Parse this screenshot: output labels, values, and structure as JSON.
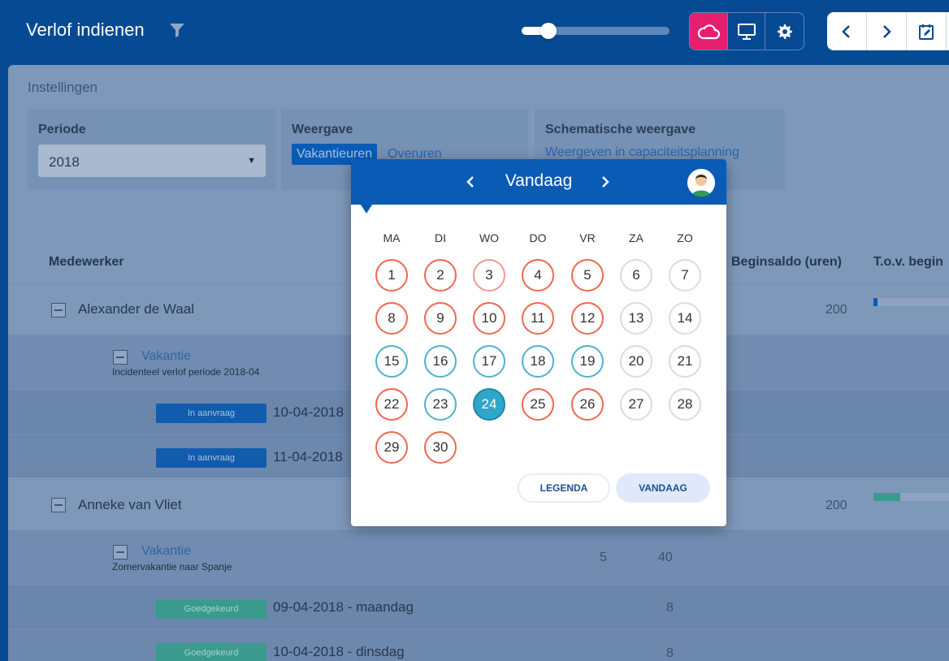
{
  "header": {
    "title": "Verlof indienen",
    "zoom_level": 0.18
  },
  "settings": {
    "title": "Instellingen",
    "periode": {
      "label": "Periode",
      "value": "2018"
    },
    "weergave": {
      "label": "Weergave",
      "options": [
        "Vakantieuren",
        "Overuren"
      ],
      "selected": "Vakantieuren"
    },
    "schematisch": {
      "label": "Schematische weergave",
      "link": "Weergeven in capaciteitsplanning"
    }
  },
  "table": {
    "headers": {
      "employee": "Medewerker",
      "start_balance": "Beginsaldo (uren)",
      "compared": "T.o.v. begin"
    },
    "employees": [
      {
        "name": "Alexander de Waal",
        "start_balance": "200",
        "bar_fraction": 0.05,
        "category": "Vakantie",
        "description": "Incidenteel verlof periode 2018-04",
        "requests": [
          {
            "status": "In aanvraag",
            "date": "10-04-2018"
          },
          {
            "status": "In aanvraag",
            "date": "11-04-2018"
          }
        ]
      },
      {
        "name": "Anneke van Vliet",
        "start_balance": "200",
        "bar_fraction": 0.35,
        "category": "Vakantie",
        "description": "Zomervakantie naar Spanje",
        "cat_days": "5",
        "cat_hours": "40",
        "requests": [
          {
            "status": "Goedgekeurd",
            "date": "09-04-2018 - maandag",
            "hours": "8"
          },
          {
            "status": "Goedgekeurd",
            "date": "10-04-2018 - dinsdag",
            "hours": "8"
          }
        ]
      }
    ]
  },
  "calendar": {
    "title": "Vandaag",
    "weekdays": [
      "MA",
      "DI",
      "WO",
      "DO",
      "VR",
      "ZA",
      "ZO"
    ],
    "days": [
      {
        "n": "1",
        "s": "red"
      },
      {
        "n": "2",
        "s": "red"
      },
      {
        "n": "3",
        "s": "red-light"
      },
      {
        "n": "4",
        "s": "red"
      },
      {
        "n": "5",
        "s": "red"
      },
      {
        "n": "6",
        "s": "weekend"
      },
      {
        "n": "7",
        "s": "weekend"
      },
      {
        "n": "8",
        "s": "red"
      },
      {
        "n": "9",
        "s": "red"
      },
      {
        "n": "10",
        "s": "red"
      },
      {
        "n": "11",
        "s": "red"
      },
      {
        "n": "12",
        "s": "red"
      },
      {
        "n": "13",
        "s": "weekend"
      },
      {
        "n": "14",
        "s": "weekend"
      },
      {
        "n": "15",
        "s": "teal"
      },
      {
        "n": "16",
        "s": "teal"
      },
      {
        "n": "17",
        "s": "teal"
      },
      {
        "n": "18",
        "s": "teal"
      },
      {
        "n": "19",
        "s": "teal"
      },
      {
        "n": "20",
        "s": "weekend"
      },
      {
        "n": "21",
        "s": "weekend"
      },
      {
        "n": "22",
        "s": "red"
      },
      {
        "n": "23",
        "s": "teal"
      },
      {
        "n": "24",
        "s": "today"
      },
      {
        "n": "25",
        "s": "red"
      },
      {
        "n": "26",
        "s": "red"
      },
      {
        "n": "27",
        "s": "weekend"
      },
      {
        "n": "28",
        "s": "weekend"
      },
      {
        "n": "29",
        "s": "red"
      },
      {
        "n": "30",
        "s": "red"
      }
    ],
    "legend_button": "LEGENDA",
    "today_button": "VANDAAG"
  },
  "colors": {
    "header": "#064a93",
    "accent_pink": "#e61e6e",
    "calendar_head": "#0a5bb5",
    "red_ring": "#f0674f",
    "teal_ring": "#4cb3cd",
    "today_fill": "#2fa7c8"
  }
}
